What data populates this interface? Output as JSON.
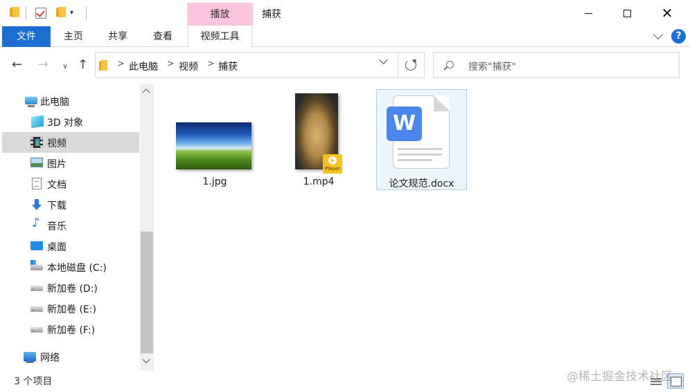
{
  "titlebar": {
    "context_tab": "播放",
    "title": "捕获"
  },
  "ribbon": {
    "tabs": [
      "文件",
      "主页",
      "共享",
      "查看",
      "视频工具"
    ],
    "help": "?"
  },
  "nav": {
    "breadcrumb": [
      "此电脑",
      "视频",
      "捕获"
    ],
    "separator": ">",
    "search_placeholder": "搜索\"捕获\""
  },
  "tree": [
    {
      "label": "此电脑",
      "icon": "computer-icon"
    },
    {
      "label": "3D 对象",
      "icon": "3d-objects-icon"
    },
    {
      "label": "视频",
      "icon": "videos-icon",
      "selected": true
    },
    {
      "label": "图片",
      "icon": "pictures-icon"
    },
    {
      "label": "文档",
      "icon": "documents-icon"
    },
    {
      "label": "下载",
      "icon": "downloads-icon"
    },
    {
      "label": "音乐",
      "icon": "music-icon"
    },
    {
      "label": "桌面",
      "icon": "desktop-icon"
    },
    {
      "label": "本地磁盘 (C:)",
      "icon": "drive-c-icon"
    },
    {
      "label": "新加卷 (D:)",
      "icon": "drive-icon"
    },
    {
      "label": "新加卷 (E:)",
      "icon": "drive-icon"
    },
    {
      "label": "新加卷 (F:)",
      "icon": "drive-icon"
    },
    {
      "label": "网络",
      "icon": "network-icon"
    }
  ],
  "files": [
    {
      "name": "1.jpg",
      "type": "image"
    },
    {
      "name": "1.mp4",
      "type": "video",
      "badge": "Player"
    },
    {
      "name": "论文规范.docx",
      "type": "document",
      "logo": "W",
      "selected": true
    }
  ],
  "status": {
    "count": "3 个项目"
  },
  "watermark": "@稀土掘金技术社区",
  "colors": {
    "accent": "#1c6fd0",
    "context_tab": "#fbc5dd",
    "selection": "#eef6fd"
  }
}
